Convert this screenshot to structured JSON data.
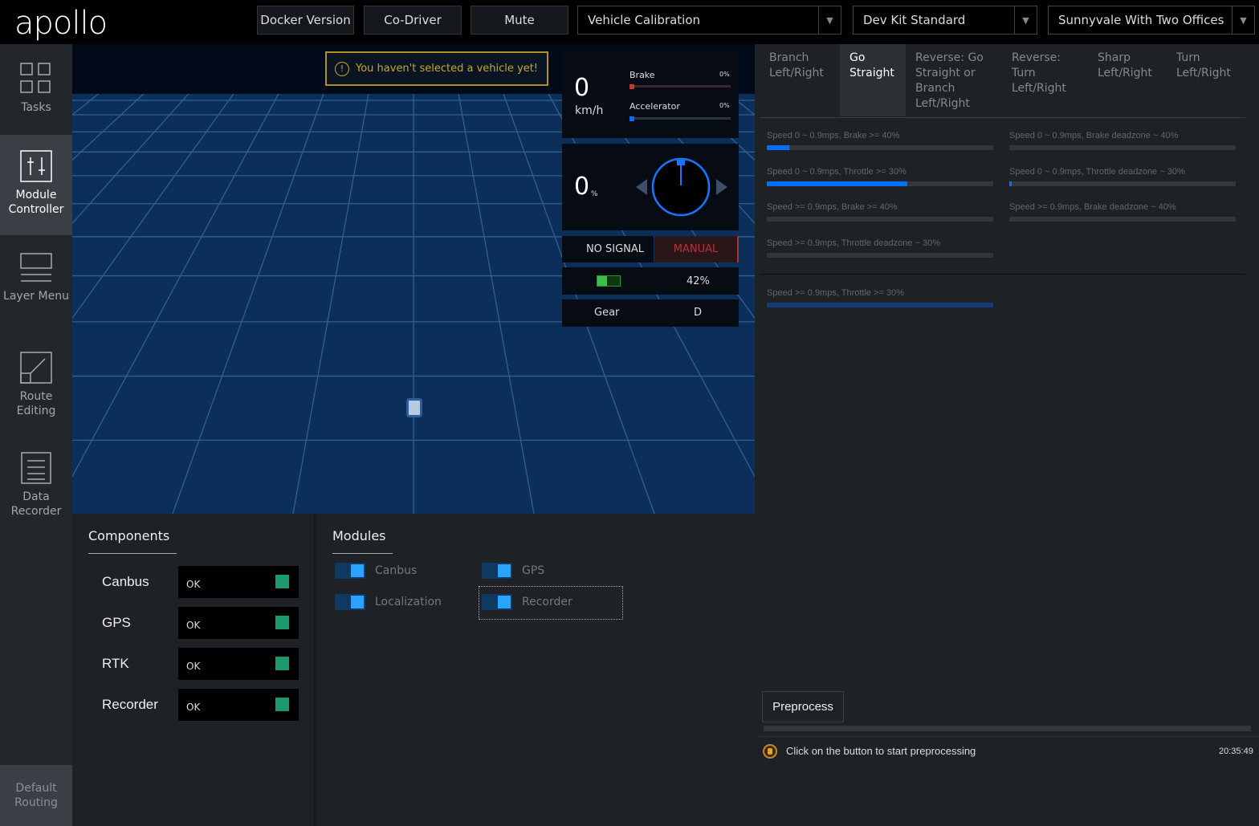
{
  "header": {
    "logo": "apollo",
    "buttons": [
      "Docker Version",
      "Co-Driver",
      "Mute"
    ],
    "selects": [
      "Vehicle Calibration",
      "Dev Kit Standard",
      "Sunnyvale With Two Offices"
    ]
  },
  "sidebar": {
    "items": [
      {
        "label": "Tasks",
        "icon": "grid-icon"
      },
      {
        "label": "Module Controller",
        "icon": "sliders-icon",
        "active": true
      },
      {
        "label": "Layer Menu",
        "icon": "layers-icon"
      },
      {
        "label": "Route Editing",
        "icon": "route-icon"
      },
      {
        "label": "Data Recorder",
        "icon": "document-icon"
      }
    ],
    "bottom": "Default Routing"
  },
  "scene": {
    "warning": "You haven't selected a vehicle yet!"
  },
  "dashboard": {
    "speed": "0",
    "speed_unit": "km/h",
    "brake_label": "Brake",
    "brake_value": "0%",
    "accel_label": "Accelerator",
    "accel_value": "0%",
    "steering": "0",
    "steering_unit": "%",
    "signal": "NO SIGNAL",
    "mode": "MANUAL",
    "battery": "42%",
    "battery_level": 42,
    "gear_label": "Gear",
    "gear": "D"
  },
  "components": {
    "title": "Components",
    "rows": [
      {
        "name": "Canbus",
        "status": "OK"
      },
      {
        "name": "GPS",
        "status": "OK"
      },
      {
        "name": "RTK",
        "status": "OK"
      },
      {
        "name": "Recorder",
        "status": "OK"
      }
    ]
  },
  "modules": {
    "title": "Modules",
    "items": [
      {
        "name": "Canbus",
        "on": true
      },
      {
        "name": "GPS",
        "on": true
      },
      {
        "name": "Localization",
        "on": true
      },
      {
        "name": "Recorder",
        "on": true
      }
    ]
  },
  "calibration": {
    "tabs": [
      "Branch Left/Right",
      "Go Straight",
      "Reverse: Go Straight or Branch Left/Right",
      "Reverse: Turn Left/Right",
      "Sharp Left/Right",
      "Turn Left/Right"
    ],
    "active_tab": "Go Straight",
    "progress": [
      {
        "label": "Speed 0 ~ 0.9mps, Brake >= 40%",
        "value": 10
      },
      {
        "label": "Speed 0 ~ 0.9mps, Brake deadzone ~ 40%",
        "value": 0
      },
      {
        "label": "Speed 0 ~ 0.9mps, Throttle >= 30%",
        "value": 62
      },
      {
        "label": "Speed 0 ~ 0.9mps, Throttle deadzone ~ 30%",
        "value": 1
      },
      {
        "label": "Speed >= 0.9mps, Brake >= 40%",
        "value": 0
      },
      {
        "label": "Speed >= 0.9mps, Brake deadzone ~ 40%",
        "value": 0
      },
      {
        "label": "Speed >= 0.9mps, Throttle deadzone ~ 30%",
        "value": 0
      },
      {
        "label": "Speed >= 0.9mps, Throttle >= 30%",
        "value": 100
      }
    ],
    "preprocess_button": "Preprocess",
    "log_message": "Click on the button to start preprocessing",
    "log_time": "20:35:49"
  }
}
